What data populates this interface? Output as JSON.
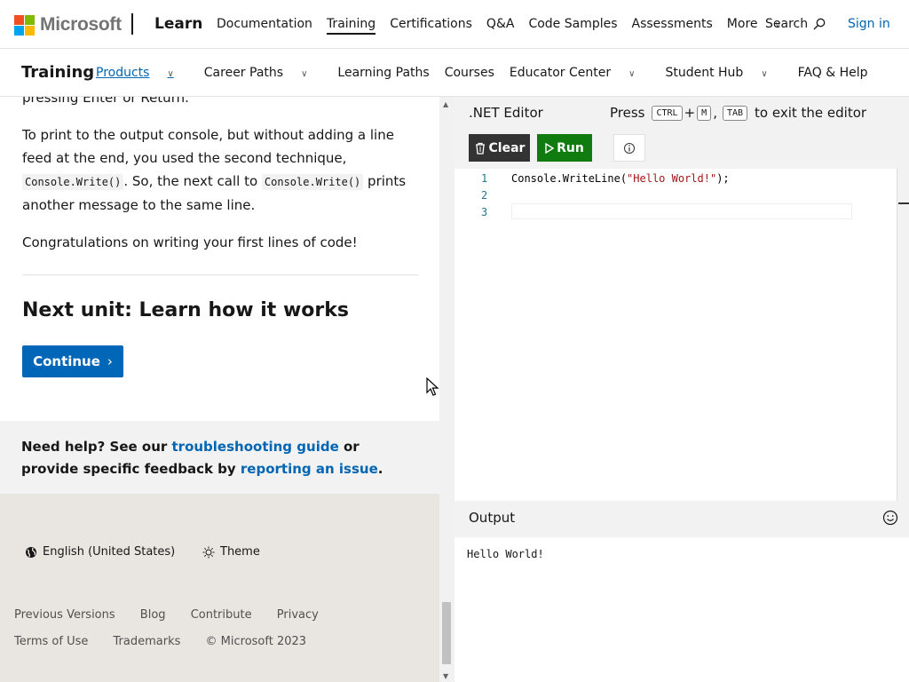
{
  "header": {
    "brand": "Microsoft",
    "product": "Learn",
    "nav": [
      "Documentation",
      "Training",
      "Certifications",
      "Q&A",
      "Code Samples",
      "Assessments",
      "More"
    ],
    "active_nav": "Training",
    "search_label": "Search",
    "signin_label": "Sign in",
    "logo_colors": [
      "#f25022",
      "#7fba00",
      "#00a4ef",
      "#ffb900"
    ]
  },
  "subnav": {
    "title": "Training",
    "items": [
      {
        "label": "Products",
        "dropdown": true
      },
      {
        "label": "Career Paths",
        "dropdown": true
      },
      {
        "label": "Learning Paths",
        "dropdown": false
      },
      {
        "label": "Courses",
        "dropdown": false
      },
      {
        "label": "Educator Center",
        "dropdown": true
      },
      {
        "label": "Student Hub",
        "dropdown": true
      },
      {
        "label": "FAQ & Help",
        "dropdown": false
      }
    ]
  },
  "article": {
    "clipped_text": "pressing Enter or Return.",
    "para1_a": "To print to the output console, but without adding a line feed at the end, you used the second technique, ",
    "para1_code1": "Console.Write()",
    "para1_b": ". So, the next call to ",
    "para1_code2": "Console.Write()",
    "para1_c": " prints another message to the same line.",
    "para2": "Congratulations on writing your first lines of code!",
    "next_heading": "Next unit: Learn how it works",
    "continue_label": "Continue"
  },
  "help": {
    "prefix": "Need help? See our ",
    "link1": "troubleshooting guide",
    "middle": " or provide specific feedback by ",
    "link2": "reporting an issue",
    "suffix": "."
  },
  "footer": {
    "language": "English (United States)",
    "theme": "Theme",
    "links": [
      "Previous Versions",
      "Blog",
      "Contribute",
      "Privacy",
      "Terms of Use",
      "Trademarks",
      "© Microsoft 2023"
    ]
  },
  "editor": {
    "title": ".NET Editor",
    "press": "Press",
    "key1": "CTRL",
    "plus": "+",
    "key2": "M",
    "comma": ",",
    "key3": "TAB",
    "exit_text": "to exit the editor",
    "clear_label": "Clear",
    "run_label": "Run",
    "line_numbers": [
      "1",
      "2",
      "3"
    ],
    "code_prefix": "Console.WriteLine(",
    "code_string": "\"Hello World!\"",
    "code_suffix": ");",
    "output_title": "Output",
    "output_text": "Hello World!"
  }
}
